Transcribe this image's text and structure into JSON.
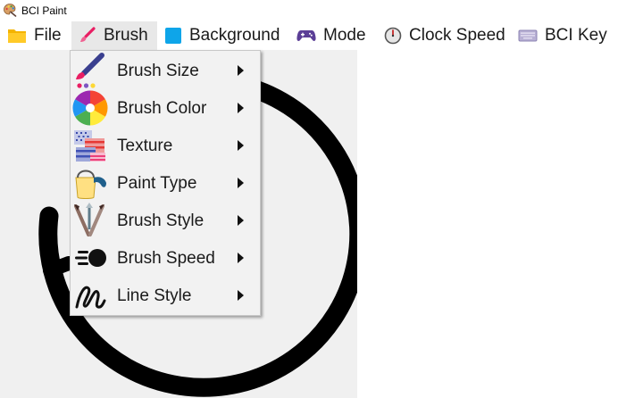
{
  "app": {
    "title": "BCI Paint"
  },
  "menubar": {
    "items": [
      {
        "label": "File",
        "icon": "folder-icon"
      },
      {
        "label": "Brush",
        "icon": "paintbrush-icon"
      },
      {
        "label": "Background",
        "icon": "blue-square-icon"
      },
      {
        "label": "Mode",
        "icon": "gamepad-icon"
      },
      {
        "label": "Clock Speed",
        "icon": "stopwatch-icon"
      },
      {
        "label": "BCI Key",
        "icon": "keyboard-icon"
      }
    ],
    "open_menu": "Brush"
  },
  "brush_menu": {
    "items": [
      {
        "label": "Brush Size",
        "icon": "brush-size-icon"
      },
      {
        "label": "Brush Color",
        "icon": "color-wheel-icon"
      },
      {
        "label": "Texture",
        "icon": "texture-icon"
      },
      {
        "label": "Paint Type",
        "icon": "paint-bucket-icon"
      },
      {
        "label": "Brush Style",
        "icon": "brushes-icon"
      },
      {
        "label": "Brush Speed",
        "icon": "speed-icon"
      },
      {
        "label": "Line Style",
        "icon": "squiggle-icon"
      }
    ]
  },
  "colors": {
    "canvas_background": "#f0f0f0",
    "stroke": "#000000",
    "menu_background": "#f2f2f2",
    "active_menu": "#e8e8e8",
    "accent_blue": "#0ea5e9"
  }
}
